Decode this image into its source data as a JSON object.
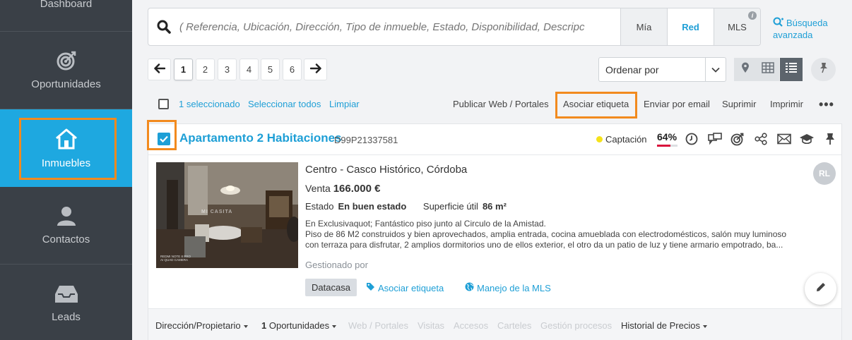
{
  "sidebar": {
    "items": [
      {
        "label": "Dashboard",
        "icon": "dashboard-icon"
      },
      {
        "label": "Oportunidades",
        "icon": "target-icon"
      },
      {
        "label": "Inmuebles",
        "icon": "house-icon",
        "active": true
      },
      {
        "label": "Contactos",
        "icon": "person-icon"
      },
      {
        "label": "Leads",
        "icon": "inbox-icon"
      }
    ]
  },
  "search": {
    "placeholder": "( Referencia, Ubicación, Dirección, Tipo de inmueble, Estado, Disponibilidad, Descripc",
    "scopes": [
      "Mía",
      "Red",
      "MLS"
    ],
    "active_scope": "Red",
    "advanced_line1": "Búsqueda",
    "advanced_line2": "avanzada"
  },
  "pagination": {
    "pages": [
      "1",
      "2",
      "3",
      "4",
      "5",
      "6"
    ],
    "current": "1"
  },
  "sort": {
    "label": "Ordenar por"
  },
  "selection": {
    "count_text": "1 seleccionado",
    "select_all": "Seleccionar todos",
    "clear": "Limpiar"
  },
  "actions": {
    "publish": "Publicar Web / Portales",
    "tag": "Asociar etiqueta",
    "email": "Enviar por email",
    "delete": "Suprimir",
    "print": "Imprimir"
  },
  "property": {
    "title": "Apartamento 2 Habitaciones",
    "reference": "D99P21337581",
    "status": "Captación",
    "completeness": "64%",
    "completeness_value": 0.64,
    "location": "Centro - Casco Histórico, Córdoba",
    "price_type": "Venta",
    "price": "166.000 €",
    "estado_label": "Estado",
    "estado_value": "En buen estado",
    "surface_label": "Superficie útil",
    "surface_value": "86 m²",
    "description_line1": "En Exclusivaquot; Fantástico piso junto al Circulo de la Amistad.",
    "description_line2": "Piso de 86 M2 construidos y bien aprovechados, amplia entrada, cocina amueblada con electrodomésticos, salón muy luminoso",
    "description_line3": "con terraza para disfrutar, 2 amplios dormitorios uno de ellos exterior, el otro da un patio de luz y tiene armario empotrado, ba...",
    "managed_by": "Gestionado por",
    "agency_tag": "Datacasa",
    "tag_link": "Asociar etiqueta",
    "mls_link": "Manejo de la MLS",
    "avatar_initials": "RL",
    "photo_watermark": "MI CASITA",
    "photo_caption_1": "REDMI NOTE 8 PRO",
    "photo_caption_2": "AI QUAD CAMERA"
  },
  "footer_tabs": {
    "owner": "Dirección/Propietario",
    "opp_count": "1",
    "opp_label": "Oportunidades",
    "web": "Web / Portales",
    "visits": "Visitas",
    "access": "Accesos",
    "signs": "Carteles",
    "process": "Gestión procesos",
    "price_history": "Historial de Precios"
  },
  "colors": {
    "accent": "#1ea8e0",
    "highlight": "#f28a1e",
    "sidebar": "#3a4047",
    "progress": "#d9123c",
    "status_dot": "#f5e21a"
  }
}
